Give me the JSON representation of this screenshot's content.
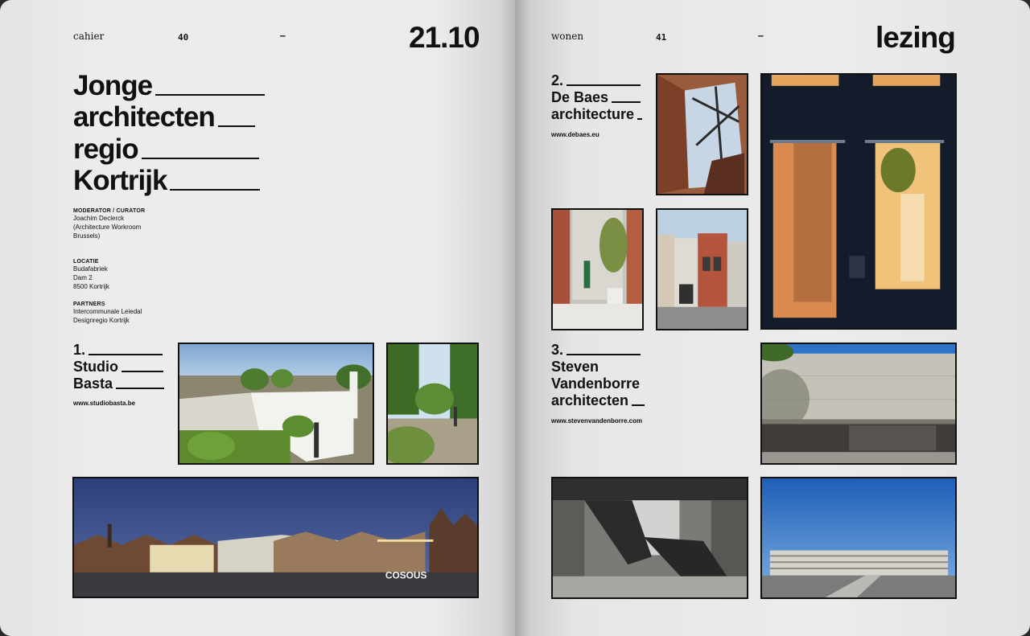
{
  "left_page": {
    "section": "cahier",
    "page_number": "40",
    "dash": "–",
    "date": "21.10",
    "title_lines": [
      "Jonge",
      "architecten",
      "regio",
      "Kortrijk"
    ],
    "moderator": {
      "label": "MODERATOR / CURATOR",
      "lines": [
        "Joachim Declerck",
        "(Architecture Workroom",
        "Brussels)"
      ]
    },
    "location": {
      "label": "LOCATIE",
      "lines": [
        "Budafabriek",
        "Dam 2",
        "8500 Kortrijk"
      ]
    },
    "partners": {
      "label": "PARTNERS",
      "lines": [
        "Intercommunale Leiedal",
        "Designregio Kortrijk"
      ]
    },
    "architect_1": {
      "title_lines": [
        "1.",
        "Studio",
        "Basta"
      ],
      "url": "www.studiobasta.be"
    },
    "photo_sign": "COSOUS"
  },
  "right_page": {
    "section": "wonen",
    "page_number": "41",
    "dash": "–",
    "heading": "lezing",
    "architect_2": {
      "title_lines": [
        "2.",
        "De Baes",
        "architecture"
      ],
      "url": "www.debaes.eu"
    },
    "architect_3": {
      "title_lines": [
        "3.",
        "Steven",
        "Vandenborre",
        "architecten"
      ],
      "url": "www.stevenvandenborre.com"
    }
  },
  "colors": {
    "ink": "#111111",
    "paper": "#ebebeb",
    "accent_brick": "#b0603d",
    "sky_blue": "#2f6fc4"
  }
}
